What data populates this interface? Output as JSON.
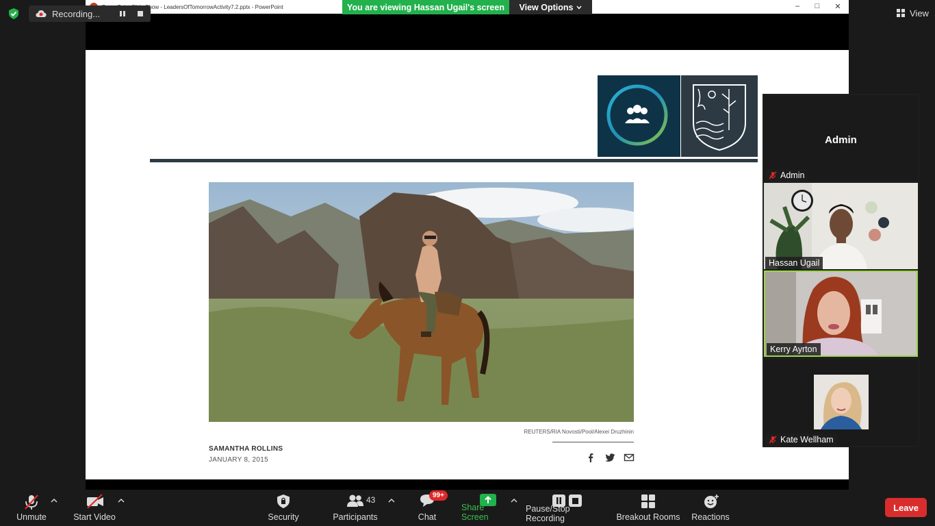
{
  "top": {
    "recording_label": "Recording...",
    "view_label": "View"
  },
  "shared_window": {
    "title": "PowerPoint Slide Show  -  LeadersOfTomorrowActivity7.2.pptx  -  PowerPoint",
    "minimize": "–",
    "maximize": "□",
    "close": "✕"
  },
  "viewing_banner": {
    "text": "You are viewing Hassan Ugail's screen",
    "view_options": "View Options"
  },
  "slide": {
    "credit": "REUTERS/RIA Novosti/Pool/Alexei Druzhinin",
    "author": "SAMANTHA ROLLINS",
    "date": "JANUARY 8, 2015"
  },
  "participants_panel": {
    "tiles": [
      {
        "display_name": "Admin",
        "label": "Admin",
        "muted": true
      },
      {
        "label": "Hassan Ugail",
        "muted": false
      },
      {
        "label": "Kerry Ayrton",
        "muted": false,
        "active_speaker": true
      },
      {
        "label": "Kate Wellham",
        "muted": true
      }
    ]
  },
  "toolbar": {
    "unmute": "Unmute",
    "start_video": "Start Video",
    "security": "Security",
    "participants": "Participants",
    "participants_count": "43",
    "chat": "Chat",
    "chat_badge": "99+",
    "share_screen": "Share Screen",
    "pause_recording": "Pause/Stop Recording",
    "breakout_rooms": "Breakout Rooms",
    "reactions": "Reactions",
    "leave": "Leave"
  },
  "colors": {
    "share_green": "#22b14c",
    "leave_red": "#d92d2d",
    "active_speaker": "#9bd64b",
    "slide_navy": "#2d3a44"
  }
}
